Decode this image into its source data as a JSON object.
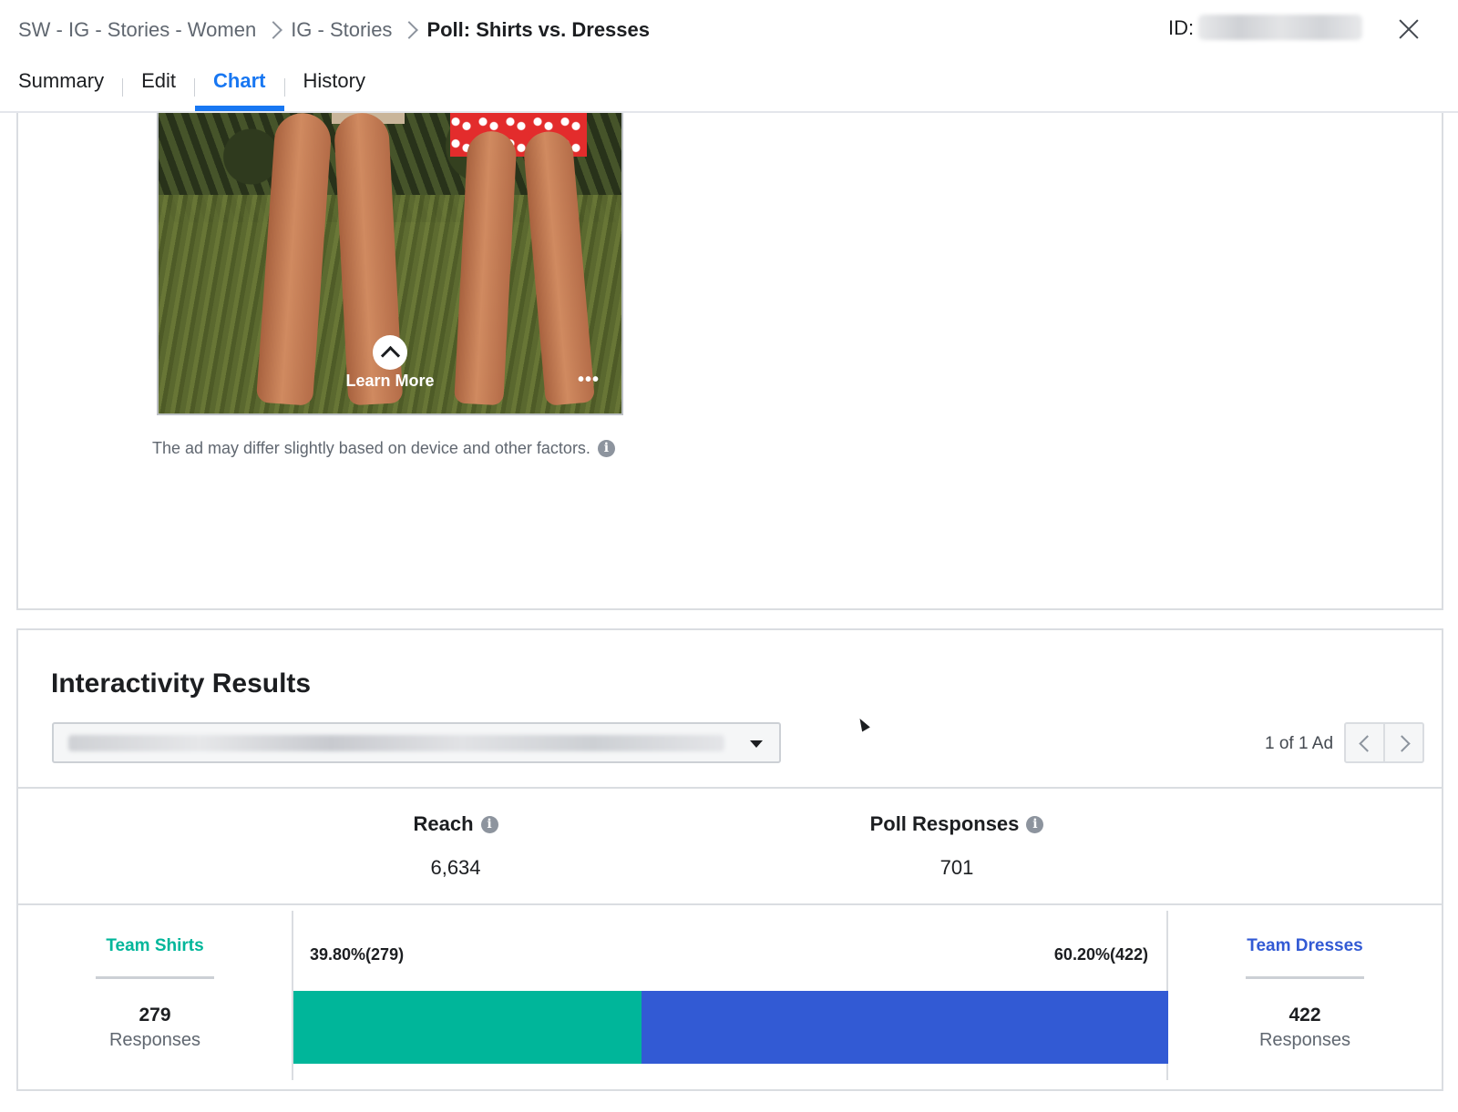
{
  "header": {
    "breadcrumbs": [
      "SW - IG - Stories - Women",
      "IG - Stories",
      "Poll: Shirts vs. Dresses"
    ],
    "id_label": "ID:"
  },
  "tabs": [
    {
      "label": "Summary",
      "active": false
    },
    {
      "label": "Edit",
      "active": false
    },
    {
      "label": "Chart",
      "active": true
    },
    {
      "label": "History",
      "active": false
    }
  ],
  "preview": {
    "cta_label": "Learn More",
    "more_label": "•••",
    "note": "The ad may differ slightly based on device and other factors."
  },
  "interactivity": {
    "title": "Interactivity Results",
    "ad_count": "1 of 1 Ad",
    "metrics": [
      {
        "label": "Reach",
        "value": "6,634"
      },
      {
        "label": "Poll Responses",
        "value": "701"
      }
    ],
    "poll": {
      "options": [
        {
          "name": "Team Shirts",
          "count": "279",
          "responses_label": "Responses",
          "percent_label": "39.80%(279)",
          "fraction": 0.398,
          "color": "#00b69a"
        },
        {
          "name": "Team Dresses",
          "count": "422",
          "responses_label": "Responses",
          "percent_label": "60.20%(422)",
          "fraction": 0.602,
          "color": "#325ad4"
        }
      ]
    }
  },
  "colors": {
    "accent": "#1877f2",
    "team_shirts": "#00b69a",
    "team_dresses": "#325ad4"
  }
}
